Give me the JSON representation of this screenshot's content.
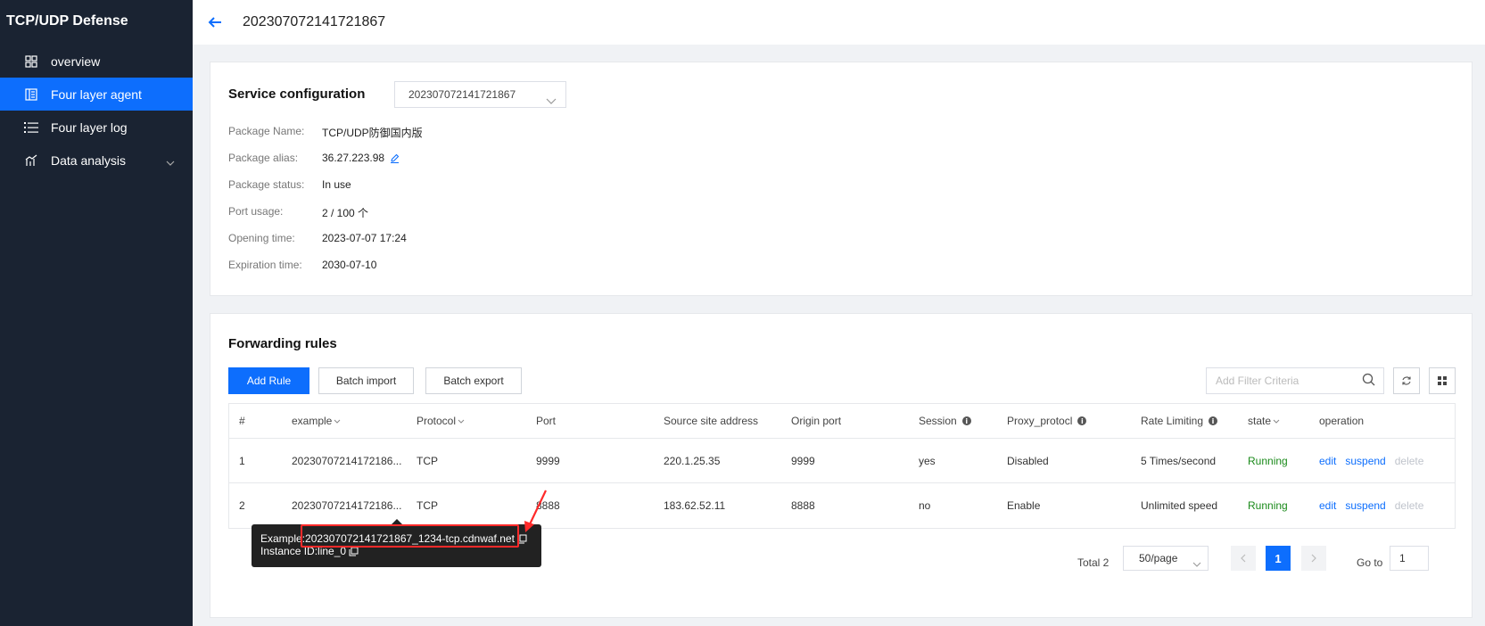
{
  "sidebar": {
    "brand": "TCP/UDP Defense",
    "items": [
      {
        "label": "overview",
        "icon": "grid-icon"
      },
      {
        "label": "Four layer agent",
        "icon": "agent-icon",
        "active": true
      },
      {
        "label": "Four layer log",
        "icon": "list-icon"
      },
      {
        "label": "Data analysis",
        "icon": "chart-icon",
        "has_submenu": true
      }
    ]
  },
  "header": {
    "title": "202307072141721867"
  },
  "service": {
    "title": "Service configuration",
    "selected_service": "202307072141721867",
    "fields": [
      {
        "label": "Package Name:",
        "value": "TCP/UDP防御国内版"
      },
      {
        "label": "Package alias:",
        "value": "36.27.223.98",
        "editable": true
      },
      {
        "label": "Package status:",
        "value": "In use"
      },
      {
        "label": "Port usage:",
        "value": "2 / 100 个"
      },
      {
        "label": "Opening time:",
        "value": "2023-07-07 17:24"
      },
      {
        "label": "Expiration time:",
        "value": "2030-07-10"
      }
    ]
  },
  "rules": {
    "title": "Forwarding rules",
    "add_label": "Add Rule",
    "import_label": "Batch import",
    "export_label": "Batch export",
    "filter_placeholder": "Add Filter Criteria",
    "columns": [
      "#",
      "example",
      "Protocol",
      "Port",
      "Source site address",
      "Origin port",
      "Session",
      "Proxy_protocl",
      "Rate Limiting",
      "state",
      "operation"
    ],
    "rows": [
      {
        "num": "1",
        "example": "20230707214172186...",
        "protocol": "TCP",
        "port": "9999",
        "source": "220.1.25.35",
        "origin_port": "9999",
        "session": "yes",
        "proxy": "Disabled",
        "rate": "5 Times/second",
        "state": "Running"
      },
      {
        "num": "2",
        "example": "20230707214172186...",
        "protocol": "TCP",
        "port": "8888",
        "source": "183.62.52.11",
        "origin_port": "8888",
        "session": "no",
        "proxy": "Enable",
        "rate": "Unlimited speed",
        "state": "Running"
      }
    ],
    "ops": {
      "edit": "edit",
      "suspend": "suspend",
      "delete": "delete"
    },
    "pagination": {
      "total": "Total 2",
      "page_size": "50/page",
      "current": "1",
      "goto_label": "Go to",
      "goto_value": "1"
    }
  },
  "tooltip": {
    "example_prefix": "Example:",
    "example_value": "202307072141721867_1234-tcp.cdnwaf.net",
    "instance": "Instance ID:line_0"
  },
  "colors": {
    "sidebar_bg": "#1a2332",
    "accent": "#0d6efd",
    "running": "#1a8a1a",
    "highlight": "#ff2a2a"
  }
}
